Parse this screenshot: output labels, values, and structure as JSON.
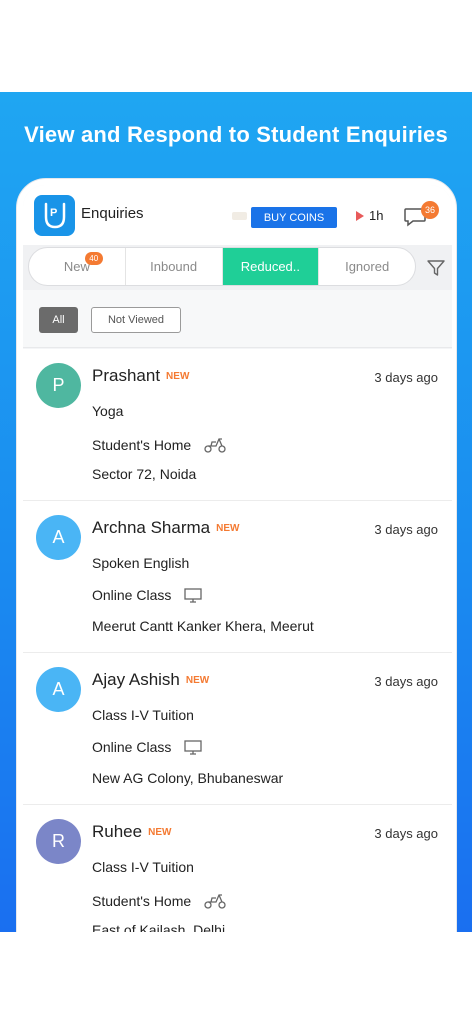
{
  "headline": "View and Respond to Student Enquiries",
  "app": {
    "title": "Enquiries",
    "logo_letter": "P",
    "buy_coins_label": "BUY COINS",
    "timer": "1h",
    "chat_badge": "36"
  },
  "tabs": [
    {
      "label": "New",
      "badge": "40",
      "active": false
    },
    {
      "label": "Inbound",
      "badge": "",
      "active": false
    },
    {
      "label": "Reduced..",
      "badge": "",
      "active": true
    },
    {
      "label": "Ignored",
      "badge": "",
      "active": false
    }
  ],
  "filters": {
    "all": "All",
    "not_viewed": "Not Viewed"
  },
  "enquiries": [
    {
      "initial": "P",
      "avatar_color": "#4fb7a0",
      "name": "Prashant",
      "tag": "NEW",
      "date": "3 days ago",
      "subject": "Yoga",
      "mode": "Student's Home",
      "mode_icon": "scooter-icon",
      "location": "Sector 72, Noida"
    },
    {
      "initial": "A",
      "avatar_color": "#4ab5f5",
      "name": "Archna Sharma",
      "tag": "NEW",
      "date": "3 days ago",
      "subject": "Spoken English",
      "mode": "Online Class",
      "mode_icon": "monitor-icon",
      "location": "Meerut Cantt Kanker Khera, Meerut"
    },
    {
      "initial": "A",
      "avatar_color": "#4ab5f5",
      "name": "Ajay Ashish",
      "tag": "NEW",
      "date": "3 days ago",
      "subject": "Class I-V Tuition",
      "mode": "Online Class",
      "mode_icon": "monitor-icon",
      "location": "New AG Colony, Bhubaneswar"
    },
    {
      "initial": "R",
      "avatar_color": "#7b86c8",
      "name": "Ruhee",
      "tag": "NEW",
      "date": "3 days ago",
      "subject": "Class I-V Tuition",
      "mode": "Student's Home",
      "mode_icon": "scooter-icon",
      "location": "East of Kailash, Delhi"
    }
  ],
  "colors": {
    "accent": "#1fcf97",
    "brand": "#1a73e8",
    "badge": "#f47a32"
  }
}
